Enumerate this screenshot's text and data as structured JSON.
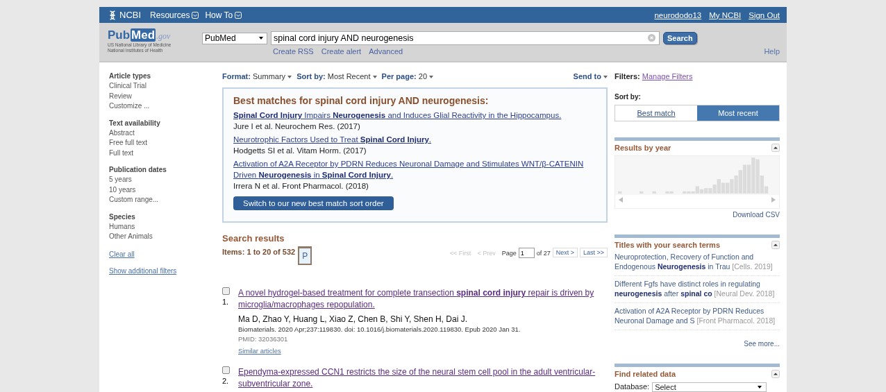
{
  "header": {
    "brand": "NCBI",
    "menus": [
      {
        "label": "Resources"
      },
      {
        "label": "How To"
      }
    ],
    "user_links": [
      "neurododo13",
      "My NCBI",
      "Sign Out"
    ]
  },
  "search_bar": {
    "logo": {
      "pub": "Pub",
      "med": "Med",
      "gov": ".gov"
    },
    "logo_lines": [
      "US National Library of Medicine",
      "National Institutes of Health"
    ],
    "database": "PubMed",
    "query": "spinal cord injury AND neurogenesis",
    "button": "Search",
    "links": [
      "Create RSS",
      "Create alert",
      "Advanced"
    ],
    "help": "Help"
  },
  "sidebar": {
    "groups": [
      {
        "title": "Article types",
        "items": [
          "Clinical Trial",
          "Review",
          "Customize ..."
        ]
      },
      {
        "title": "Text availability",
        "items": [
          "Abstract",
          "Free full text",
          "Full text"
        ]
      },
      {
        "title": "Publication dates",
        "items": [
          "5 years",
          "10 years",
          "Custom range..."
        ]
      },
      {
        "title": "Species",
        "items": [
          "Humans",
          "Other Animals"
        ]
      }
    ],
    "links": [
      "Clear all",
      "Show additional filters"
    ]
  },
  "toolbar": {
    "options": [
      {
        "label": "Format:",
        "value": "Summary"
      },
      {
        "label": "Sort by:",
        "value": "Most Recent"
      },
      {
        "label": "Per page:",
        "value": "20"
      }
    ],
    "send_to": "Send to"
  },
  "best_matches": {
    "title": "Best matches for spinal cord injury AND neurogenesis:",
    "items": [
      {
        "title": "**Spinal Cord Injury** Impairs **Neurogenesis** and Induces Glial Reactivity in the Hippocampus.",
        "source": "Jure I et al. Neurochem Res. (2017)"
      },
      {
        "title": "Neurotrophic Factors Used to Treat **Spinal Cord Injury**.",
        "source": "Hodgetts SI et al. Vitam Horm. (2017)"
      },
      {
        "title": "Activation of A2A Receptor by PDRN Reduces Neuronal Damage and Stimulates WNT/β-CATENIN Driven **Neurogenesis** in **Spinal Cord Injury**.",
        "source": "Irrera N et al. Front Pharmacol. (2018)"
      }
    ],
    "button": "Switch to our new best match sort order"
  },
  "results": {
    "title": "Search results",
    "count": "Items: 1 to 20 of 532",
    "clipboard": "P",
    "pager": {
      "items": [
        {
          "label": "<< First",
          "disabled": true
        },
        {
          "label": "< Prev",
          "disabled": true
        }
      ],
      "page_label": "Page",
      "page": "1",
      "of": "of 27",
      "buttons": [
        "Next >",
        "Last >>"
      ]
    },
    "items": [
      {
        "checked": false,
        "number": "1.",
        "title": "A novel hydrogel-based treatment for complete transection **spinal cord injury** repair is driven by microglia/macrophages repopulation.",
        "authors": "Ma D, Zhao Y, Huang L, Xiao Z, Chen B, Shi Y, Shen H, Dai J.",
        "citation": "Biomaterials. 2020 Apr;237:119830. doi: 10.1016/j.biomaterials.2020.119830. Epub 2020 Jan 31.",
        "pmid": "PMID: 32036301",
        "similar": "Similar articles"
      },
      {
        "checked": false,
        "number": "2.",
        "title": "Ependyma-expressed CCN1 restricts the size of the neural stem cell pool in the adult ventricular-subventricular zone."
      }
    ]
  },
  "right": {
    "filters_label": "Filters:",
    "filters_link": "Manage Filters",
    "sort_label": "Sort by:",
    "sort_options": [
      {
        "label": "Best match",
        "selected": false
      },
      {
        "label": "Most recent",
        "selected": true
      }
    ],
    "year_panel": {
      "title": "Results by year",
      "link": "Download CSV"
    },
    "titles_panel": {
      "title": "Titles with your search terms",
      "items": [
        {
          "title": "Neuroprotection, Recovery of Function and Endogenous **Neurogenesis** in Trau",
          "source": "[Cells. 2019]"
        },
        {
          "title": "Different Fgfs have distinct roles in regulating **neurogenesis** after **spinal co**",
          "source": "[Neural Dev. 2018]"
        },
        {
          "title": "Activation of A2A Receptor by PDRN Reduces Neuronal Damage and S",
          "source": "[Front Pharmacol. 2018]"
        }
      ],
      "more": "See more..."
    },
    "related_panel": {
      "title": "Find related data",
      "label": "Database:",
      "select": "Select"
    }
  }
}
